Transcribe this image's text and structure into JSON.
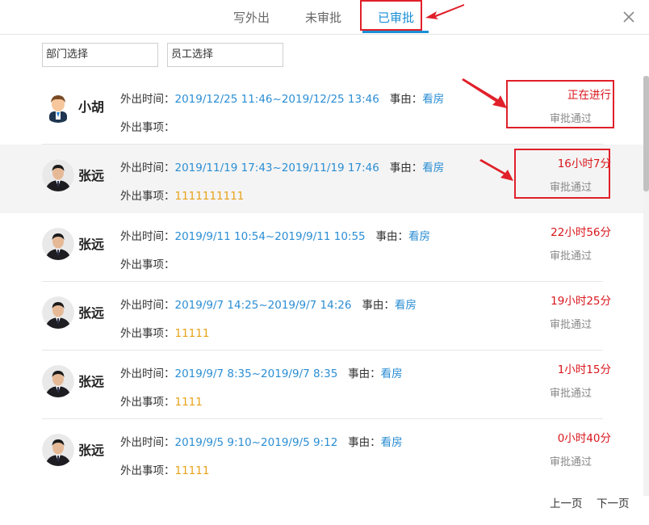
{
  "tabs": [
    {
      "label": "写外出"
    },
    {
      "label": "未审批"
    },
    {
      "label": "已审批"
    }
  ],
  "filters": {
    "department": "部门选择",
    "employee": "员工选择"
  },
  "labels": {
    "time": "外出时间：",
    "reason": "事由：",
    "matter": "外出事项："
  },
  "records": [
    {
      "name": "小胡",
      "time": "2019/12/25 11:46~2019/12/25 13:46",
      "reason": "看房",
      "matter": "",
      "status": "正在进行",
      "approval": "审批通过",
      "avatar": "cartoon-avatar"
    },
    {
      "name": "张远",
      "time": "2019/11/19 17:43~2019/11/19 17:46",
      "reason": "看房",
      "matter": "1111111111",
      "status": "16小时7分",
      "approval": "审批通过",
      "avatar": "photo-avatar"
    },
    {
      "name": "张远",
      "time": "2019/9/11 10:54~2019/9/11 10:55",
      "reason": "看房",
      "matter": "",
      "status": "22小时56分",
      "approval": "审批通过",
      "avatar": "photo-avatar"
    },
    {
      "name": "张远",
      "time": "2019/9/7 14:25~2019/9/7 14:26",
      "reason": "看房",
      "matter": "11111",
      "status": "19小时25分",
      "approval": "审批通过",
      "avatar": "photo-avatar"
    },
    {
      "name": "张远",
      "time": "2019/9/7 8:35~2019/9/7 8:35",
      "reason": "看房",
      "matter": "1111",
      "status": "1小时15分",
      "approval": "审批通过",
      "avatar": "photo-avatar"
    },
    {
      "name": "张远",
      "time": "2019/9/5 9:10~2019/9/5 9:12",
      "reason": "看房",
      "matter": "11111",
      "status": "0小时40分",
      "approval": "审批通过",
      "avatar": "photo-avatar"
    }
  ],
  "pager": {
    "prev": "上一页",
    "next": "下一页"
  },
  "colors": {
    "accent": "#1a8fd6",
    "status": "#d9161c",
    "matter": "#e8a21a",
    "highlight": "#e0202a"
  }
}
